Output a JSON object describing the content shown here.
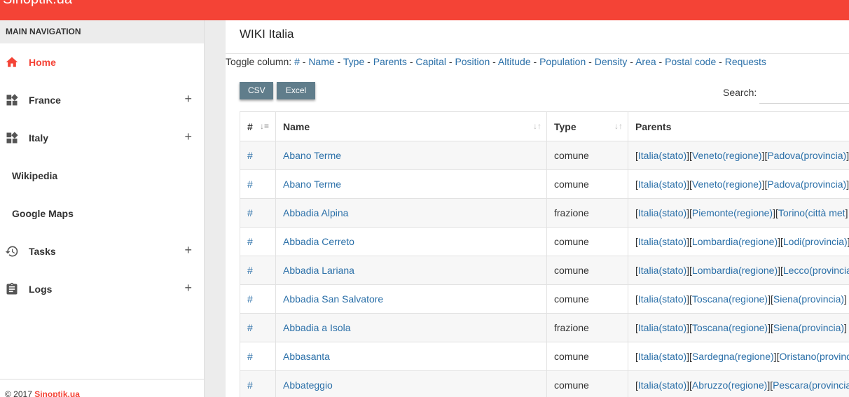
{
  "sidebar": {
    "header": "MAIN NAVIGATION",
    "items": [
      {
        "label": "Home",
        "icon": "home-icon",
        "active": true
      },
      {
        "label": "France",
        "icon": "widgets-icon",
        "expandable": true
      },
      {
        "label": "Italy",
        "icon": "widgets-icon",
        "expandable": true
      },
      {
        "label": "Wikipedia"
      },
      {
        "label": "Google Maps"
      },
      {
        "label": "Tasks",
        "icon": "history-icon",
        "expandable": true
      },
      {
        "label": "Logs",
        "icon": "clipboard-icon",
        "expandable": true
      }
    ],
    "footer": {
      "prefix": "© 2017 ",
      "link": "Sinoptik.ua"
    }
  },
  "colors": {
    "accent": "#f44336",
    "button": "#607d8b",
    "link": "#2a6fa8"
  },
  "main": {
    "title": "WIKI Italia",
    "toggle": {
      "label": "Toggle column:",
      "columns": [
        "#",
        "Name",
        "Type",
        "Parents",
        "Capital",
        "Position",
        "Altitude",
        "Population",
        "Density",
        "Area",
        "Postal code",
        "Requests"
      ]
    },
    "buttons": {
      "csv": "CSV",
      "excel": "Excel"
    },
    "search_label": "Search:",
    "table": {
      "headers": [
        "#",
        "Name",
        "Type",
        "Parents"
      ],
      "rows": [
        {
          "hash": "#",
          "name": "Abano Terme",
          "type": "comune",
          "parents": [
            "Italia(stato)",
            "Veneto(regione)",
            "Padova(provincia)"
          ]
        },
        {
          "hash": "#",
          "name": "Abano Terme",
          "type": "comune",
          "parents": [
            "Italia(stato)",
            "Veneto(regione)",
            "Padova(provincia)"
          ]
        },
        {
          "hash": "#",
          "name": "Abbadia Alpina",
          "type": "frazione",
          "parents": [
            "Italia(stato)",
            "Piemonte(regione)",
            "Torino(città met"
          ]
        },
        {
          "hash": "#",
          "name": "Abbadia Cerreto",
          "type": "comune",
          "parents": [
            "Italia(stato)",
            "Lombardia(regione)",
            "Lodi(provincia)"
          ]
        },
        {
          "hash": "#",
          "name": "Abbadia Lariana",
          "type": "comune",
          "parents": [
            "Italia(stato)",
            "Lombardia(regione)",
            "Lecco(provincia"
          ]
        },
        {
          "hash": "#",
          "name": "Abbadia San Salvatore",
          "type": "comune",
          "parents": [
            "Italia(stato)",
            "Toscana(regione)",
            "Siena(provincia)"
          ]
        },
        {
          "hash": "#",
          "name": "Abbadia a Isola",
          "type": "frazione",
          "parents": [
            "Italia(stato)",
            "Toscana(regione)",
            "Siena(provincia)"
          ]
        },
        {
          "hash": "#",
          "name": "Abbasanta",
          "type": "comune",
          "parents": [
            "Italia(stato)",
            "Sardegna(regione)",
            "Oristano(provinc"
          ]
        },
        {
          "hash": "#",
          "name": "Abbateggio",
          "type": "comune",
          "parents": [
            "Italia(stato)",
            "Abruzzo(regione)",
            "Pescara(provincia"
          ]
        }
      ]
    }
  }
}
